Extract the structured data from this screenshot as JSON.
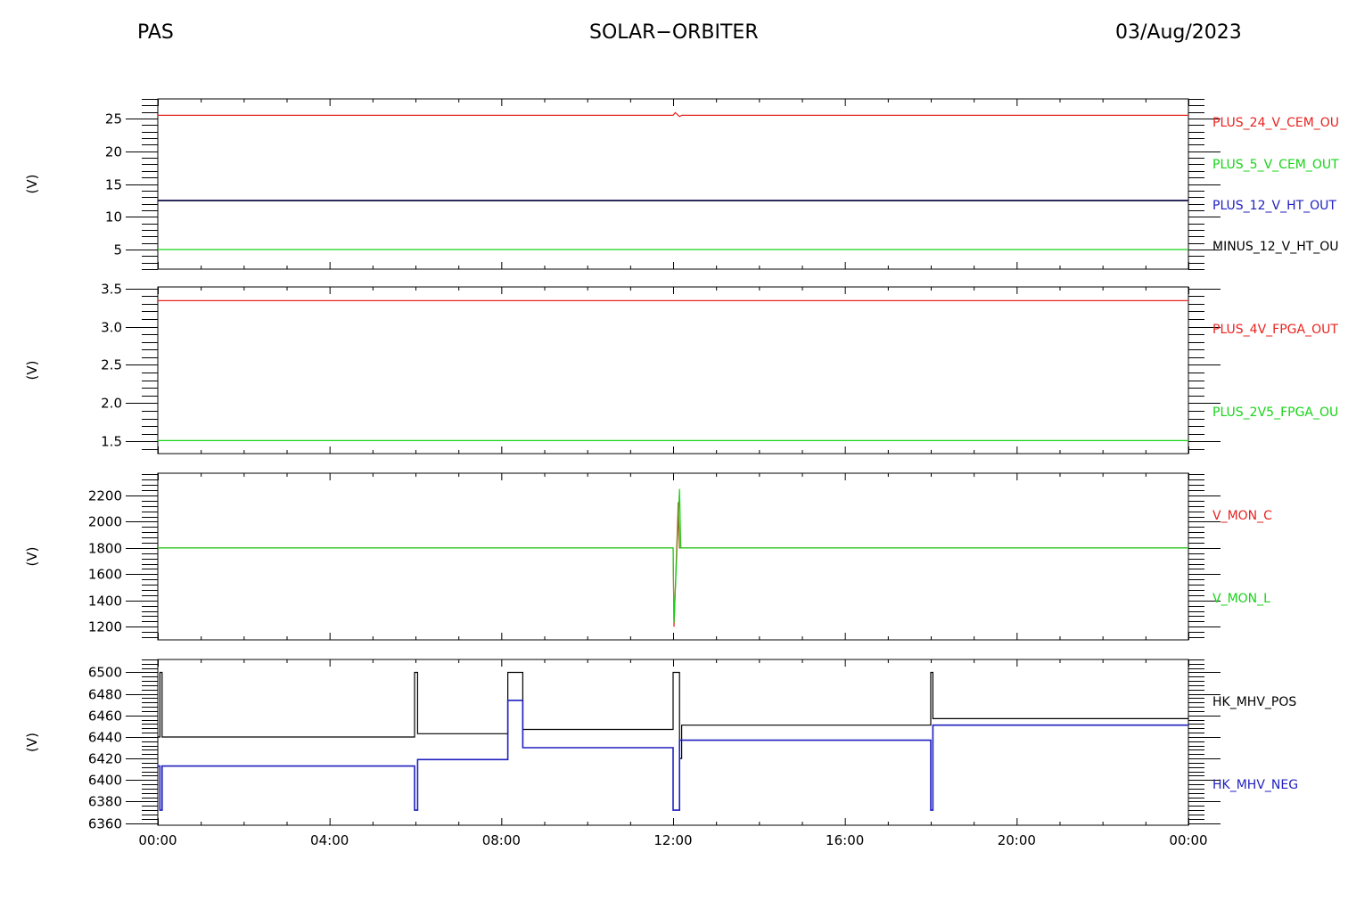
{
  "header": {
    "left": "PAS",
    "center": "SOLAR−ORBITER",
    "right": "03/Aug/2023"
  },
  "chart_data": [
    {
      "type": "line",
      "ylabel": "(V)",
      "ylim": [
        2,
        28
      ],
      "yticks": [
        5,
        10,
        15,
        20,
        25
      ],
      "xlim": [
        0,
        24
      ],
      "series": [
        {
          "name": "PLUS_24_V_CEM_OU",
          "color": "#e8231f",
          "x": [
            0,
            12,
            12.05,
            12.1,
            12.15,
            12.2,
            24
          ],
          "y": [
            25.5,
            25.5,
            25.9,
            25.6,
            25.3,
            25.5,
            25.5
          ]
        },
        {
          "name": "PLUS_5_V_CEM_OUT",
          "color": "#17d417",
          "x": [
            0,
            24
          ],
          "y": [
            5,
            5
          ]
        },
        {
          "name": "PLUS_12_V_HT_OUT",
          "color": "#1f1fbf",
          "x": [
            0,
            24
          ],
          "y": [
            12.5,
            12.5
          ]
        },
        {
          "name": "MINUS_12_V_HT_OU",
          "color": "#000000",
          "x": [
            0,
            24
          ],
          "y": [
            12.45,
            12.45
          ]
        }
      ]
    },
    {
      "type": "line",
      "ylabel": "(V)",
      "ylim": [
        1.34,
        3.52
      ],
      "yticks": [
        1.5,
        2.0,
        2.5,
        3.0,
        3.5
      ],
      "yticklabels": [
        "1.5",
        "2.0",
        "2.5",
        "3.0",
        "3.5"
      ],
      "xlim": [
        0,
        24
      ],
      "series": [
        {
          "name": "PLUS_4V_FPGA_OUT",
          "color": "#e8231f",
          "x": [
            0,
            24
          ],
          "y": [
            3.34,
            3.34
          ]
        },
        {
          "name": "PLUS_2V5_FPGA_OU",
          "color": "#17d417",
          "x": [
            0,
            24
          ],
          "y": [
            1.51,
            1.51
          ]
        }
      ]
    },
    {
      "type": "line",
      "ylabel": "(V)",
      "ylim": [
        1100,
        2370
      ],
      "yticks": [
        1200,
        1400,
        1600,
        1800,
        2000,
        2200
      ],
      "xlim": [
        0,
        24
      ],
      "series": [
        {
          "name": "V_MON_C",
          "color": "#e8231f",
          "x": [
            0,
            12,
            12.02,
            12.12,
            12.15,
            24
          ],
          "y": [
            1800,
            1800,
            1200,
            2150,
            1800,
            1800
          ]
        },
        {
          "name": "V_MON_L",
          "color": "#17d417",
          "x": [
            0,
            12,
            12.02,
            12.15,
            12.18,
            24
          ],
          "y": [
            1800,
            1800,
            1230,
            2250,
            1800,
            1800
          ]
        }
      ]
    },
    {
      "type": "line",
      "ylabel": "(V)",
      "ylim": [
        6358,
        6512
      ],
      "yticks": [
        6360,
        6380,
        6400,
        6420,
        6440,
        6460,
        6480,
        6500
      ],
      "xlim": [
        0,
        24
      ],
      "xticks": [
        0,
        4,
        8,
        12,
        16,
        20,
        24
      ],
      "xticklabels": [
        "00:00",
        "04:00",
        "08:00",
        "12:00",
        "16:00",
        "20:00",
        "00:00"
      ],
      "series": [
        {
          "name": "HK_MHV_POS",
          "color": "#000000",
          "x": [
            0,
            0.05,
            0.05,
            0.1,
            0.1,
            5.98,
            5.98,
            6.05,
            6.05,
            8.15,
            8.15,
            8.5,
            8.5,
            12.0,
            12.0,
            12.15,
            12.15,
            12.2,
            12.2,
            18.0,
            18.0,
            18.05,
            18.05,
            24
          ],
          "y": [
            6440,
            6440,
            6500,
            6500,
            6440,
            6440,
            6500,
            6500,
            6443,
            6443,
            6500,
            6500,
            6447,
            6447,
            6500,
            6500,
            6420,
            6420,
            6451,
            6451,
            6500,
            6500,
            6457,
            6457
          ]
        },
        {
          "name": "HK_MHV_NEG",
          "color": "#1f1fbf",
          "x": [
            0,
            0.05,
            0.05,
            0.1,
            0.1,
            5.98,
            5.98,
            6.05,
            6.05,
            8.15,
            8.15,
            8.5,
            8.5,
            12.0,
            12.0,
            12.15,
            12.15,
            12.2,
            12.2,
            18.0,
            18.0,
            18.05,
            18.05,
            24
          ],
          "y": [
            6413,
            6413,
            6372,
            6372,
            6413,
            6413,
            6372,
            6372,
            6419,
            6419,
            6474,
            6474,
            6430,
            6430,
            6372,
            6372,
            6437,
            6437,
            6437,
            6437,
            6372,
            6372,
            6451,
            6451
          ]
        }
      ]
    }
  ]
}
